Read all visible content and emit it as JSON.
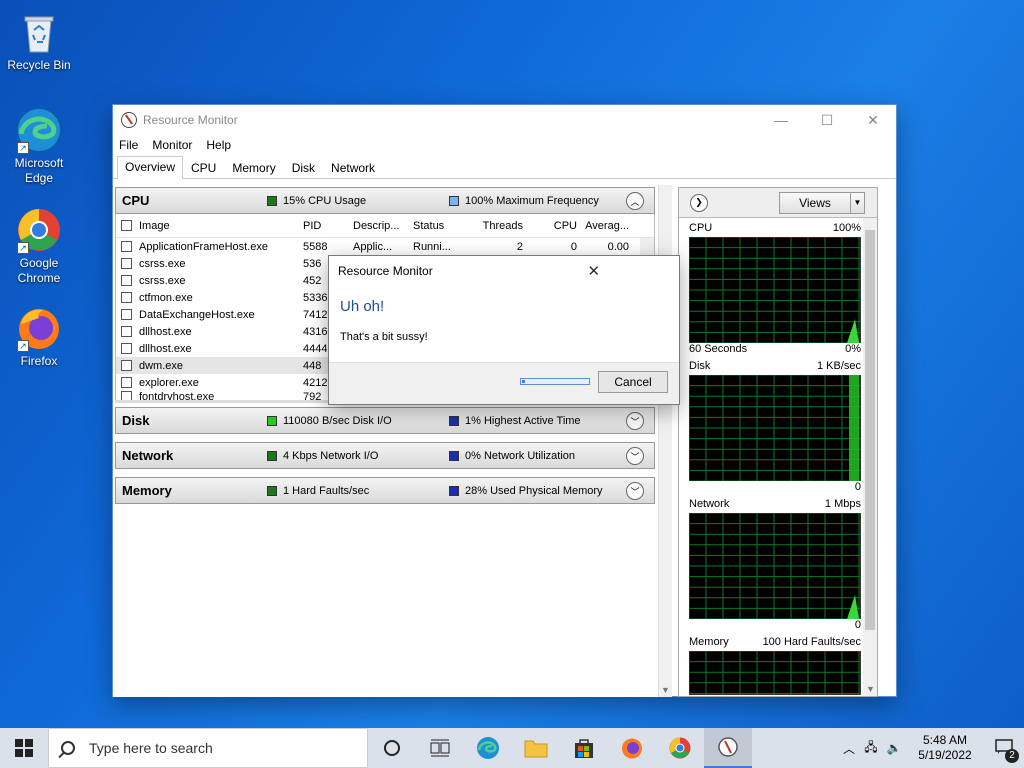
{
  "desktop": {
    "icons": [
      {
        "label": "Recycle Bin",
        "icon": "recycle-bin-icon"
      },
      {
        "label": "Microsoft Edge",
        "icon": "edge-icon"
      },
      {
        "label": "Google Chrome",
        "icon": "chrome-icon"
      },
      {
        "label": "Firefox",
        "icon": "firefox-icon"
      }
    ]
  },
  "window": {
    "title": "Resource Monitor",
    "menu": [
      "File",
      "Monitor",
      "Help"
    ],
    "tabs": [
      "Overview",
      "CPU",
      "Memory",
      "Disk",
      "Network"
    ],
    "active_tab": "Overview"
  },
  "sections": {
    "cpu": {
      "name": "CPU",
      "stat1": "15% CPU Usage",
      "stat2": "100% Maximum Frequency",
      "stat1_color": "#1a7a1a",
      "stat2_color": "#7fb2f0"
    },
    "disk": {
      "name": "Disk",
      "stat1": "110080 B/sec Disk I/O",
      "stat2": "1% Highest Active Time",
      "stat1_color": "#22cc22",
      "stat2_color": "#1a2fb0"
    },
    "network": {
      "name": "Network",
      "stat1": "4 Kbps Network I/O",
      "stat2": "0% Network Utilization",
      "stat1_color": "#1a7a1a",
      "stat2_color": "#1a2fb0"
    },
    "memory": {
      "name": "Memory",
      "stat1": "1 Hard Faults/sec",
      "stat2": "28% Used Physical Memory",
      "stat1_color": "#1a7a1a",
      "stat2_color": "#1a2fb0"
    }
  },
  "cpu_table": {
    "columns": [
      "Image",
      "PID",
      "Descrip...",
      "Status",
      "Threads",
      "CPU",
      "Averag..."
    ],
    "rows": [
      {
        "image": "ApplicationFrameHost.exe",
        "pid": "5588",
        "desc": "Applic...",
        "status": "Runni...",
        "threads": "2",
        "cpu": "0",
        "avg": "0.00"
      },
      {
        "image": "csrss.exe",
        "pid": "536",
        "desc": "",
        "status": "",
        "threads": "",
        "cpu": "",
        "avg": ""
      },
      {
        "image": "csrss.exe",
        "pid": "452",
        "desc": "",
        "status": "",
        "threads": "",
        "cpu": "",
        "avg": ""
      },
      {
        "image": "ctfmon.exe",
        "pid": "5336",
        "desc": "",
        "status": "",
        "threads": "",
        "cpu": "",
        "avg": ""
      },
      {
        "image": "DataExchangeHost.exe",
        "pid": "7412",
        "desc": "",
        "status": "",
        "threads": "",
        "cpu": "",
        "avg": ""
      },
      {
        "image": "dllhost.exe",
        "pid": "4316",
        "desc": "",
        "status": "",
        "threads": "",
        "cpu": "",
        "avg": ""
      },
      {
        "image": "dllhost.exe",
        "pid": "4444",
        "desc": "",
        "status": "",
        "threads": "",
        "cpu": "",
        "avg": ""
      },
      {
        "image": "dwm.exe",
        "pid": "448",
        "desc": "",
        "status": "",
        "threads": "",
        "cpu": "",
        "avg": ""
      },
      {
        "image": "explorer.exe",
        "pid": "4212",
        "desc": "",
        "status": "",
        "threads": "",
        "cpu": "",
        "avg": ""
      },
      {
        "image": "fontdrvhost.exe",
        "pid": "792",
        "desc": "",
        "status": "",
        "threads": "",
        "cpu": "",
        "avg": ""
      }
    ]
  },
  "right_pane": {
    "views_label": "Views",
    "graphs": {
      "cpu": {
        "name": "CPU",
        "top": "100%",
        "bottom_left": "60 Seconds",
        "bottom_right": "0%"
      },
      "disk": {
        "name": "Disk",
        "top": "1 KB/sec",
        "bottom_right": "0"
      },
      "network": {
        "name": "Network",
        "top": "1 Mbps",
        "bottom_right": "0"
      },
      "memory": {
        "name": "Memory",
        "top": "100 Hard Faults/sec"
      }
    }
  },
  "dialog": {
    "title": "Resource Monitor",
    "heading": "Uh oh!",
    "message": "That's a bit sussy!",
    "cancel_label": "Cancel",
    "progress": 0.05
  },
  "taskbar": {
    "search_placeholder": "Type here to search",
    "time": "5:48 AM",
    "date": "5/19/2022",
    "notifications": "2"
  }
}
